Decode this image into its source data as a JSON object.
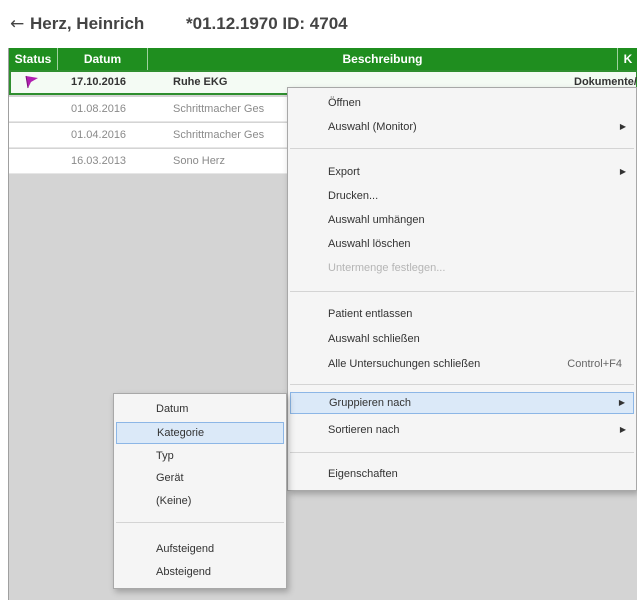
{
  "header": {
    "back_icon": "arrow-left-icon",
    "patient_name": "Herz, Heinrich",
    "patient_info": "*01.12.1970  ID: 4704"
  },
  "table": {
    "columns": [
      "Status",
      "Datum",
      "Beschreibung",
      "K"
    ],
    "rows": [
      {
        "datum": "17.10.2016",
        "beschreibung": "Ruhe EKG",
        "kategorie": "Dokumente/",
        "status_icon": "flag-icon",
        "selected": true
      },
      {
        "datum": "01.08.2016",
        "beschreibung": "Schrittmacher Ges",
        "kategorie": ""
      },
      {
        "datum": "01.04.2016",
        "beschreibung": "Schrittmacher Ges",
        "kategorie": ""
      },
      {
        "datum": "16.03.2013",
        "beschreibung": "Sono Herz",
        "kategorie": ""
      }
    ],
    "flag_color": "#b01fb0"
  },
  "context_menu": {
    "items": {
      "oeffnen": "Öffnen",
      "auswahl_monitor": "Auswahl (Monitor)",
      "export": "Export",
      "drucken": "Drucken...",
      "auswahl_umhaengen": "Auswahl umhängen",
      "auswahl_loeschen": "Auswahl löschen",
      "untermenge": "Untermenge festlegen...",
      "patient_entlassen": "Patient entlassen",
      "auswahl_schliessen": "Auswahl schließen",
      "alle_schliessen": "Alle Untersuchungen schließen",
      "alle_schliessen_shortcut": "Control+F4",
      "gruppieren": "Gruppieren nach",
      "sortieren": "Sortieren nach",
      "eigenschaften": "Eigenschaften"
    }
  },
  "group_submenu": {
    "items": {
      "datum": "Datum",
      "kategorie": "Kategorie",
      "typ": "Typ",
      "geraet": "Gerät",
      "keine": "(Keine)",
      "aufsteigend": "Aufsteigend",
      "absteigend": "Absteigend"
    }
  },
  "colors": {
    "header_green": "#1f8e1f",
    "menu_highlight": "#dbe9f8",
    "menu_highlight_border": "#8cb6e6"
  }
}
